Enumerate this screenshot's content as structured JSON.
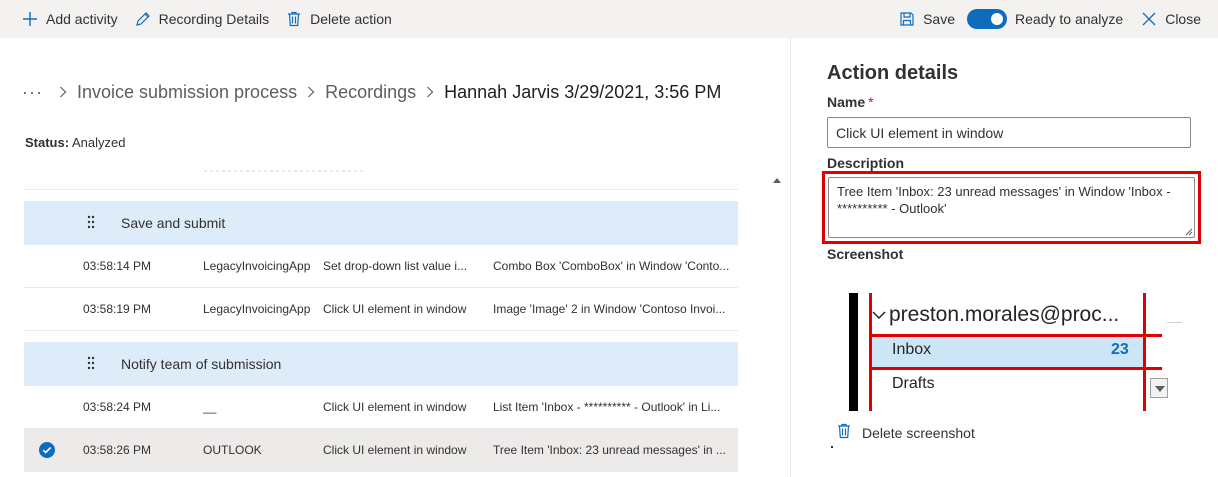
{
  "toolbar": {
    "add_activity": "Add activity",
    "recording_details": "Recording Details",
    "delete_action": "Delete action",
    "save": "Save",
    "ready_to_analyze": "Ready to analyze",
    "ready_to_analyze_on": true,
    "close": "Close"
  },
  "breadcrumb": {
    "overflow": "···",
    "items": [
      "Invoice submission process",
      "Recordings"
    ],
    "current": "Hannah Jarvis 3/29/2021, 3:56 PM"
  },
  "status": {
    "label": "Status:",
    "value": "Analyzed"
  },
  "groups": [
    {
      "title": "Save and submit",
      "rows": [
        {
          "time": "03:58:14 PM",
          "app": "LegacyInvoicingApp",
          "action": "Set drop-down list value i...",
          "description": "Combo Box 'ComboBox' in Window 'Conto...",
          "selected": false
        },
        {
          "time": "03:58:19 PM",
          "app": "LegacyInvoicingApp",
          "action": "Click UI element in window",
          "description": "Image 'Image' 2 in Window 'Contoso Invoi...",
          "selected": false
        }
      ]
    },
    {
      "title": "Notify team of submission",
      "rows": [
        {
          "time": "03:58:24 PM",
          "app": "__",
          "action": "Click UI element in window",
          "description": "List Item 'Inbox - ********** - Outlook' in Li...",
          "selected": false
        },
        {
          "time": "03:58:26 PM",
          "app": "OUTLOOK",
          "action": "Click UI element in window",
          "description": "Tree Item 'Inbox: 23 unread messages' in ...",
          "selected": true
        }
      ]
    }
  ],
  "details": {
    "title": "Action details",
    "name_label": "Name",
    "required_mark": "*",
    "name_value": "Click UI element in window",
    "description_label": "Description",
    "description_value": "Tree Item 'Inbox: 23 unread messages' in Window 'Inbox - ********** - Outlook'",
    "screenshot_label": "Screenshot",
    "screenshot": {
      "account": "preston.morales@proc...",
      "inbox": "Inbox",
      "inbox_count": "23",
      "drafts": "Drafts"
    },
    "delete_screenshot": "Delete screenshot"
  },
  "colors": {
    "accent": "#0f6cbd",
    "group_header_bg": "#deecf9",
    "highlight_red": "#e00000",
    "command_bar_bg": "#f3f2f1"
  },
  "icons": {
    "add_activity": "plus-icon",
    "recording_details": "pencil-icon",
    "delete_action": "trash-icon",
    "save": "save-icon",
    "close": "close-icon",
    "drag": "drag-grip-icon",
    "selected": "checkmark-circle-icon",
    "delete_screenshot": "trash-icon"
  }
}
